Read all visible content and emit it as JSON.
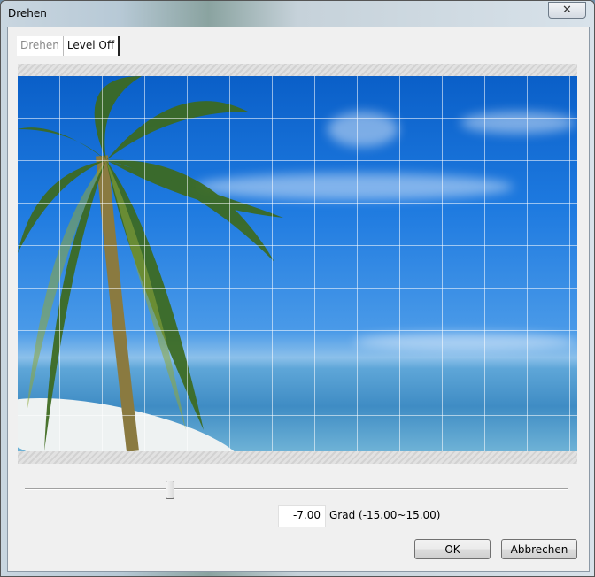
{
  "window": {
    "title": "Drehen",
    "close_icon": "close-icon"
  },
  "tabs": [
    {
      "label": "Drehen",
      "active": false
    },
    {
      "label": "Level Off",
      "active": true
    }
  ],
  "slider": {
    "min": -15.0,
    "max": 15.0,
    "value": -7.0
  },
  "angle": {
    "value": "-7.00",
    "range_label": "Grad (-15.00~15.00)"
  },
  "buttons": {
    "ok": "OK",
    "cancel": "Abbrechen"
  }
}
